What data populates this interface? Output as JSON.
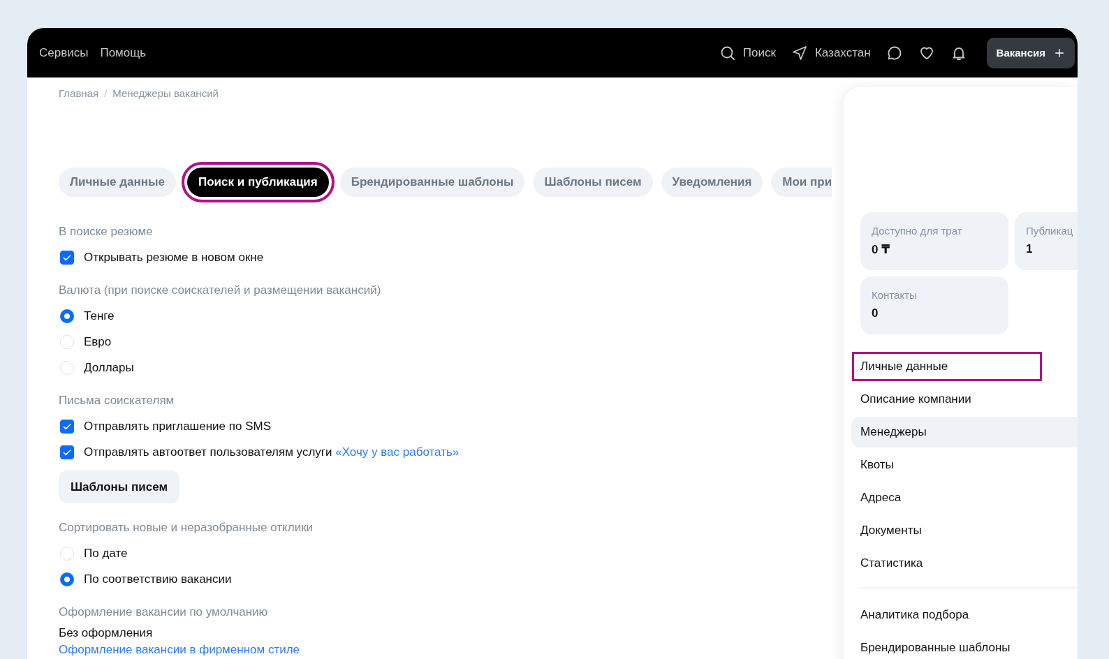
{
  "top_bar": {
    "links": [
      "Сервисы",
      "Помощь"
    ],
    "search": "Поиск",
    "location": "Казахстан",
    "action_button": "Вакансия"
  },
  "breadcrumbs": [
    "Главная",
    "Менеджеры вакансий"
  ],
  "breadcrumb_separator": "/",
  "tabs": [
    {
      "label": "Личные данные",
      "selected": false,
      "highlighted": false
    },
    {
      "label": "Поиск и публикация",
      "selected": true,
      "highlighted": true
    },
    {
      "label": "Брендированные шаблоны",
      "selected": false,
      "highlighted": false
    },
    {
      "label": "Шаблоны писем",
      "selected": false,
      "highlighted": false
    },
    {
      "label": "Уведомления",
      "selected": false,
      "highlighted": false
    },
    {
      "label": "Мои при",
      "selected": false,
      "highlighted": false
    }
  ],
  "sections": [
    {
      "heading": "В поиске резюме",
      "items": [
        {
          "kind": "checkbox",
          "label": "Открывать резюме в новом окне",
          "checked": true
        }
      ]
    },
    {
      "heading": "Валюта (при поиске соискателей и размещении вакансий)",
      "items": [
        {
          "kind": "radio",
          "label": "Тенге",
          "selected": true
        },
        {
          "kind": "radio",
          "label": "Евро",
          "selected": false
        },
        {
          "kind": "radio",
          "label": "Доллары",
          "selected": false
        }
      ]
    },
    {
      "heading": "Письма соискателям",
      "items": [
        {
          "kind": "checkbox",
          "label": "Отправлять приглашение по SMS",
          "checked": true
        },
        {
          "kind": "checkbox",
          "label": "Отправлять автоответ пользователям услуги",
          "link": "«Хочу у вас работать»",
          "checked": true
        },
        {
          "kind": "button",
          "label": "Шаблоны писем"
        }
      ]
    },
    {
      "heading": "Сортировать новые и неразобранные отклики",
      "items": [
        {
          "kind": "radio",
          "label": "По дате",
          "selected": false
        },
        {
          "kind": "radio",
          "label": "По соответствию вакансии",
          "selected": true
        }
      ]
    },
    {
      "heading": "Оформление вакансии по умолчанию",
      "items": [
        {
          "kind": "text",
          "label": "Без оформления"
        },
        {
          "kind": "link",
          "label": "Оформление вакансии в фирменном стиле"
        }
      ]
    }
  ],
  "side_panel": {
    "stats": [
      {
        "label": "Доступно для трат",
        "value": "0 ₸"
      },
      {
        "label": "Публикац",
        "value": "1"
      },
      {
        "label": "Контакты",
        "value": "0"
      }
    ],
    "menu": [
      {
        "label": "Личные данные",
        "selected": false,
        "highlighted": true
      },
      {
        "label": "Описание компании",
        "selected": false,
        "highlighted": false
      },
      {
        "label": "Менеджеры",
        "selected": true,
        "highlighted": false
      },
      {
        "label": "Квоты",
        "selected": false,
        "highlighted": false
      },
      {
        "label": "Адреса",
        "selected": false,
        "highlighted": false
      },
      {
        "label": "Документы",
        "selected": false,
        "highlighted": false
      },
      {
        "label": "Статистика",
        "selected": false,
        "highlighted": false
      }
    ],
    "more_menu": [
      {
        "label": "Аналитика подбора",
        "selected": false,
        "highlighted": false
      },
      {
        "label": "Брендированные шаблоны",
        "selected": false,
        "highlighted": false
      }
    ]
  }
}
